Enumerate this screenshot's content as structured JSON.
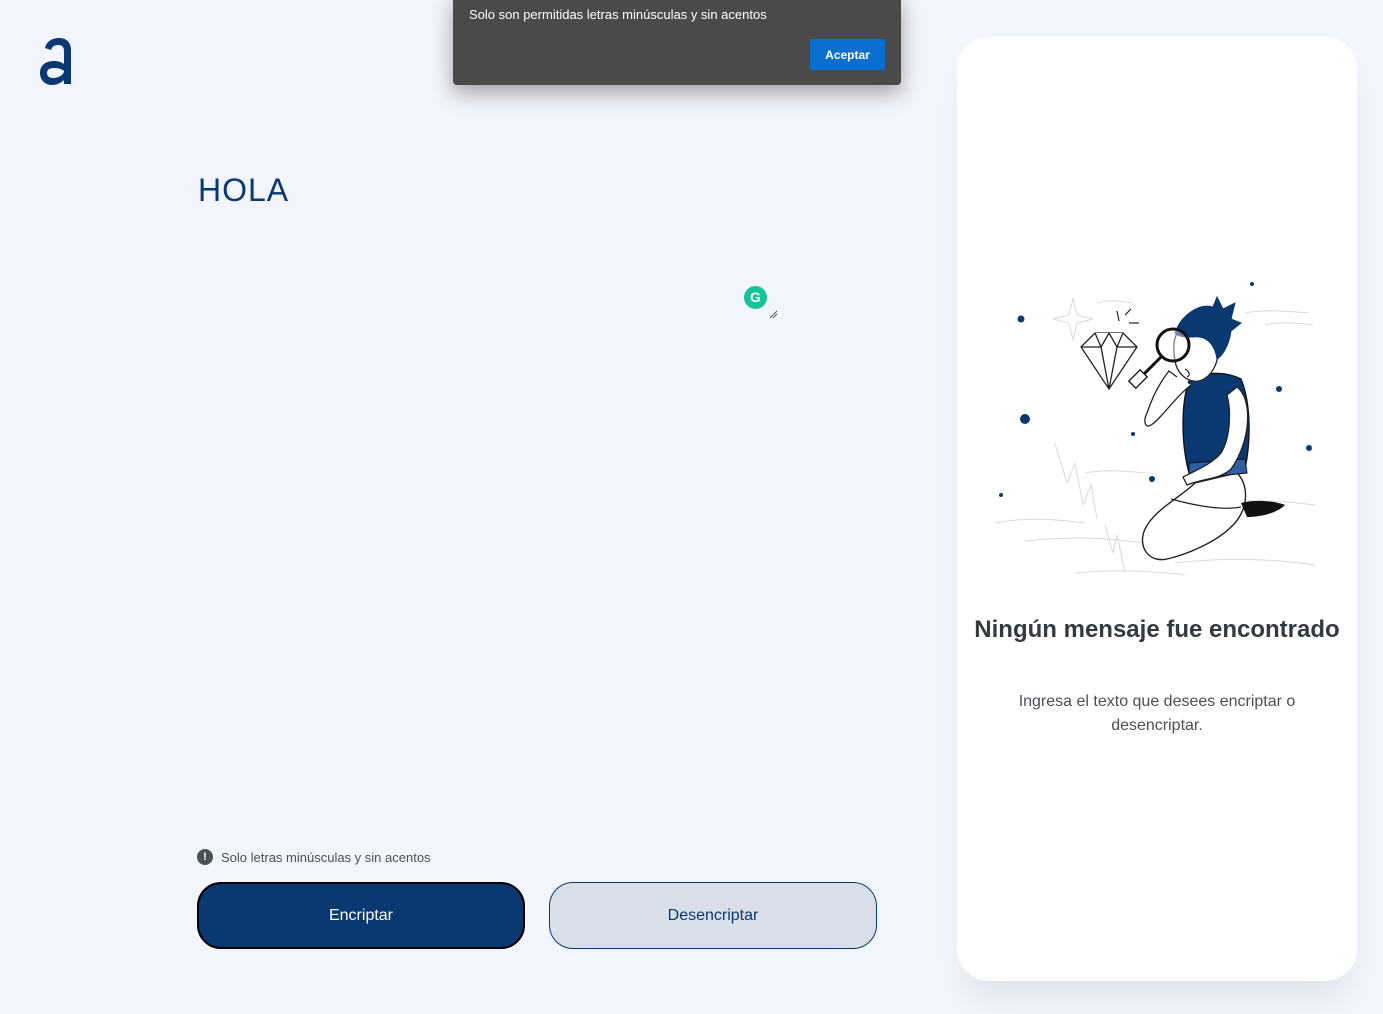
{
  "logo": {
    "letter": "a",
    "color": "#0a3871"
  },
  "input": {
    "value": "HOLA"
  },
  "grammarly": {
    "icon": "grammarly-icon",
    "glyph": "G"
  },
  "hint": {
    "icon": "exclamation-icon",
    "glyph": "!",
    "text": "Solo letras minúsculas y sin acentos"
  },
  "buttons": {
    "encrypt_label": "Encriptar",
    "decrypt_label": "Desencriptar"
  },
  "alert": {
    "message": "Solo son permitidas letras minúsculas y sin acentos",
    "ok_label": "Aceptar"
  },
  "output": {
    "title": "Ningún mensaje fue encontrado",
    "subtitle": "Ingresa el texto que desees encriptar o desencriptar.",
    "illustration": "person-with-magnifying-glass-illustration"
  },
  "colors": {
    "primary": "#0a3871",
    "background": "#f3f5fc",
    "secondary_button": "#d8dfe8",
    "alert_bg": "#4a4a4a",
    "alert_button": "#0b6fd0",
    "grammarly": "#15c39a"
  }
}
